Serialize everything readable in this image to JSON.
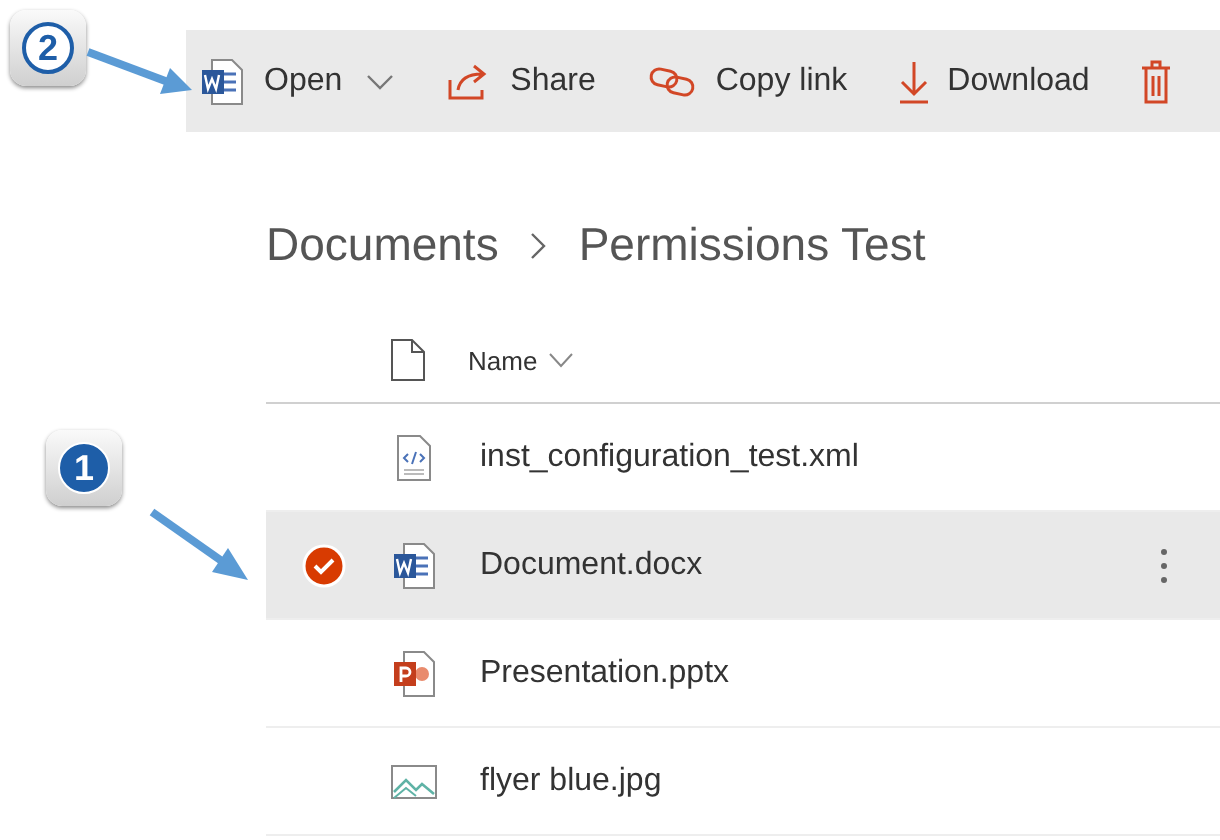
{
  "annotations": [
    {
      "number": "2",
      "kind": "outline"
    },
    {
      "number": "1",
      "kind": "filled"
    }
  ],
  "toolbar": {
    "items": [
      {
        "kind": "open",
        "label": "Open",
        "dropdown": true
      },
      {
        "kind": "share",
        "label": "Share"
      },
      {
        "kind": "link",
        "label": "Copy link"
      },
      {
        "kind": "download",
        "label": "Download"
      },
      {
        "kind": "delete"
      }
    ]
  },
  "breadcrumb": [
    "Documents",
    "Permissions Test"
  ],
  "table": {
    "columns": [
      {
        "label": "Name",
        "sortable": true
      }
    ],
    "rows": [
      {
        "name": "inst_configuration_test.xml",
        "kind": "xml",
        "selected": false
      },
      {
        "name": "Document.docx",
        "kind": "word",
        "selected": true
      },
      {
        "name": "Presentation.pptx",
        "kind": "powerpoint",
        "selected": false
      },
      {
        "name": "flyer blue.jpg",
        "kind": "image",
        "selected": false
      }
    ]
  }
}
